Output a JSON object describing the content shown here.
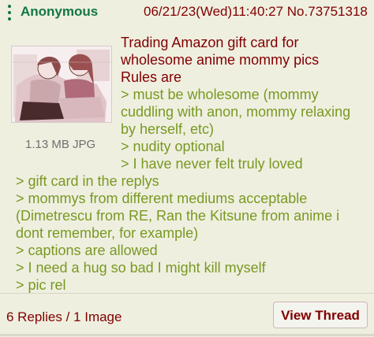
{
  "post": {
    "author": "Anonymous",
    "datetime": "06/21/23(Wed)11:40:27 No.73751318",
    "file_meta": "1.13 MB JPG",
    "lines": [
      {
        "text": "Trading Amazon gift card for",
        "type": "text"
      },
      {
        "text": "wholesome anime mommy pics",
        "type": "text"
      },
      {
        "text": "Rules are",
        "type": "text"
      },
      {
        "text": "> must be wholesome (mommy",
        "type": "quote"
      },
      {
        "text": "cuddling with anon, mommy relaxing",
        "type": "quote"
      },
      {
        "text": "by herself, etc)",
        "type": "quote"
      },
      {
        "text": "> nudity optional",
        "type": "quote"
      },
      {
        "text": "> I have never felt truly loved",
        "type": "quote"
      },
      {
        "text": "> gift card in the replys",
        "type": "quote"
      },
      {
        "text": "> mommys from different mediums acceptable",
        "type": "quote"
      },
      {
        "text": "(Dimetrescu from RE, Ran the Kitsune from anime i",
        "type": "quote"
      },
      {
        "text": "dont remember, for example)",
        "type": "quote"
      },
      {
        "text": "> captions are allowed",
        "type": "quote"
      },
      {
        "text": "> I need a hug so bad I might kill myself",
        "type": "quote"
      },
      {
        "text": "> pic rel",
        "type": "quote"
      }
    ]
  },
  "footer": {
    "replies": "6 Replies / 1 Image",
    "view_label": "View Thread"
  },
  "colors": {
    "background": "#efefe0",
    "name_green": "#117743",
    "text_maroon": "#800000",
    "greentext": "#789922"
  },
  "icons": {
    "menu": "vertical-dots-icon"
  }
}
